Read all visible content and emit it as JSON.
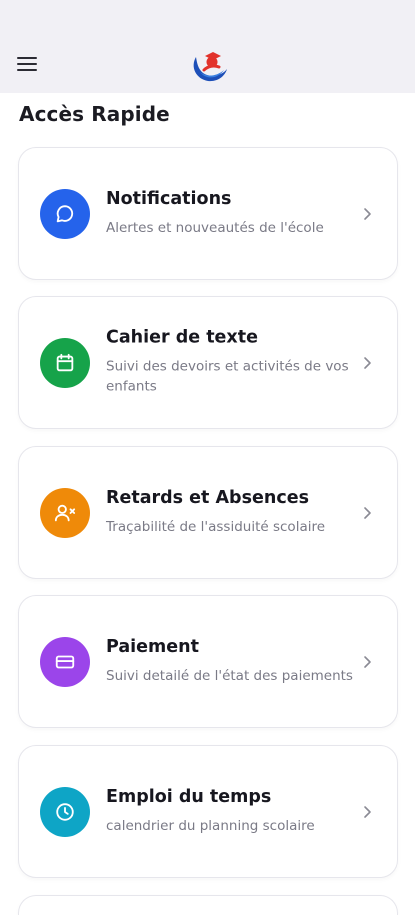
{
  "header": {
    "menu_icon": "hamburger-menu-icon",
    "logo_icon": "school-logo-icon"
  },
  "section": {
    "title": "Accès Rapide"
  },
  "colors": {
    "blue": "#2563eb",
    "green": "#16a34a",
    "orange": "#ef8a09",
    "purple": "#9b45ea",
    "cyan": "#0ea5c6"
  },
  "cards": [
    {
      "title": "Notifications",
      "subtitle": "Alertes et nouveautés de l'école",
      "icon": "chat-bubble-icon"
    },
    {
      "title": "Cahier de texte",
      "subtitle": "Suivi des devoirs et activités de vos enfants",
      "icon": "calendar-icon"
    },
    {
      "title": "Retards et Absences",
      "subtitle": "Traçabilité de l'assiduité scolaire",
      "icon": "user-x-icon"
    },
    {
      "title": "Paiement",
      "subtitle": "Suivi detailé de l'état des paiements",
      "icon": "credit-card-icon"
    },
    {
      "title": "Emploi du temps",
      "subtitle": "calendrier du planning scolaire",
      "icon": "clock-icon"
    }
  ]
}
